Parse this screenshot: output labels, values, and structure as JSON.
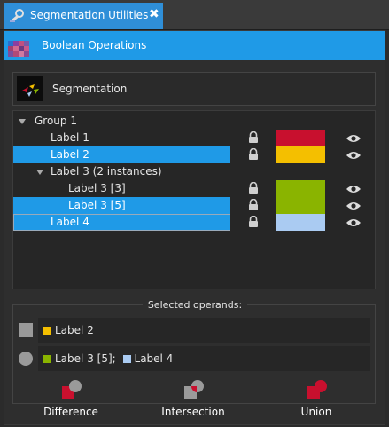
{
  "window": {
    "tab_title": "Segmentation Utilities",
    "close_glyph": "✖"
  },
  "header": {
    "title": "Boolean Operations"
  },
  "segmentation": {
    "label": "Segmentation"
  },
  "tree": {
    "rows": [
      {
        "label": "Group 1"
      },
      {
        "label": "Label 1",
        "color": "#c8102e"
      },
      {
        "label": "Label 2",
        "color": "#f4bf00"
      },
      {
        "label": "Label 3 (2 instances)"
      },
      {
        "label": "Label 3 [3]",
        "color": "#8ab400"
      },
      {
        "label": "Label 3 [5]",
        "color": "#8ab400"
      },
      {
        "label": "Label 4",
        "color": "#aacbf2"
      }
    ]
  },
  "operands": {
    "legend": "Selected operands:",
    "first": {
      "label": "Label 2",
      "color": "#f4bf00"
    },
    "second": {
      "label_a": "Label 3 [5];",
      "color_a": "#8ab400",
      "label_b": "Label 4",
      "color_b": "#aacbf2"
    }
  },
  "buttons": {
    "difference": "Difference",
    "intersection": "Intersection",
    "union": "Union"
  },
  "colors": {
    "accent": "#1f9ae7",
    "op_red": "#c8102e",
    "op_gray": "#9a9a9a"
  },
  "icons": {
    "tab": "wrench-icon",
    "header": "pixel-grid-icon",
    "lock": "lock-icon",
    "eye": "eye-icon"
  }
}
